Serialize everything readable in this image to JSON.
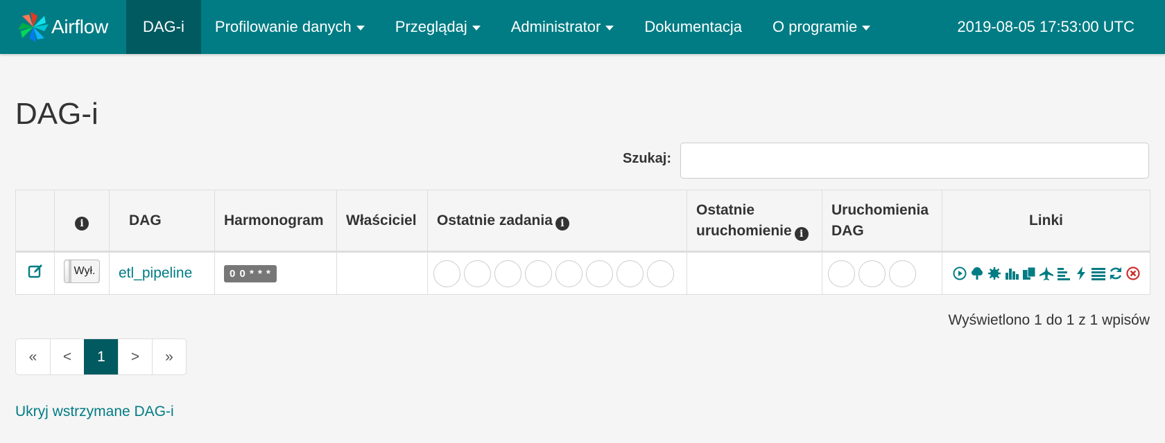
{
  "navbar": {
    "brand": "Airflow",
    "items": [
      {
        "label": "DAG-i",
        "active": true,
        "dropdown": false
      },
      {
        "label": "Profilowanie danych",
        "active": false,
        "dropdown": true
      },
      {
        "label": "Przeglądaj",
        "active": false,
        "dropdown": true
      },
      {
        "label": "Administrator",
        "active": false,
        "dropdown": true
      },
      {
        "label": "Dokumentacja",
        "active": false,
        "dropdown": false
      },
      {
        "label": "O programie",
        "active": false,
        "dropdown": true
      }
    ],
    "clock": "2019-08-05 17:53:00 UTC"
  },
  "page": {
    "title": "DAG-i",
    "search_label": "Szukaj:",
    "search_value": ""
  },
  "table": {
    "headers": {
      "info": "i",
      "dag": "DAG",
      "schedule": "Harmonogram",
      "owner": "Właściciel",
      "recent_tasks": "Ostatnie zadania",
      "last_run": "Ostatnie uruchomienie",
      "dag_runs": "Uruchomienia DAG",
      "links": "Linki"
    },
    "rows": [
      {
        "toggle_label": "Wył.",
        "dag_id": "etl_pipeline",
        "schedule": "0 0 * * *",
        "owner": "",
        "last_run": "",
        "recent_task_circles": 8,
        "dag_run_circles": 3
      }
    ],
    "link_icons": [
      "trigger-dag-icon",
      "tree-view-icon",
      "graph-view-icon",
      "task-duration-icon",
      "task-tries-icon",
      "landing-times-icon",
      "gantt-icon",
      "code-view-icon",
      "logs-icon",
      "refresh-icon",
      "delete-icon"
    ]
  },
  "info_text": "Wyświetlono 1 do 1 z 1 wpisów",
  "pagination": {
    "first": "«",
    "prev": "<",
    "current": "1",
    "next": ">",
    "last": "»"
  },
  "hide_paused_link": "Ukryj wstrzymane DAG-i",
  "colors": {
    "navbar": "#017c84",
    "navbar_active": "#015a60",
    "link": "#017c84",
    "delete": "#c9302c"
  }
}
